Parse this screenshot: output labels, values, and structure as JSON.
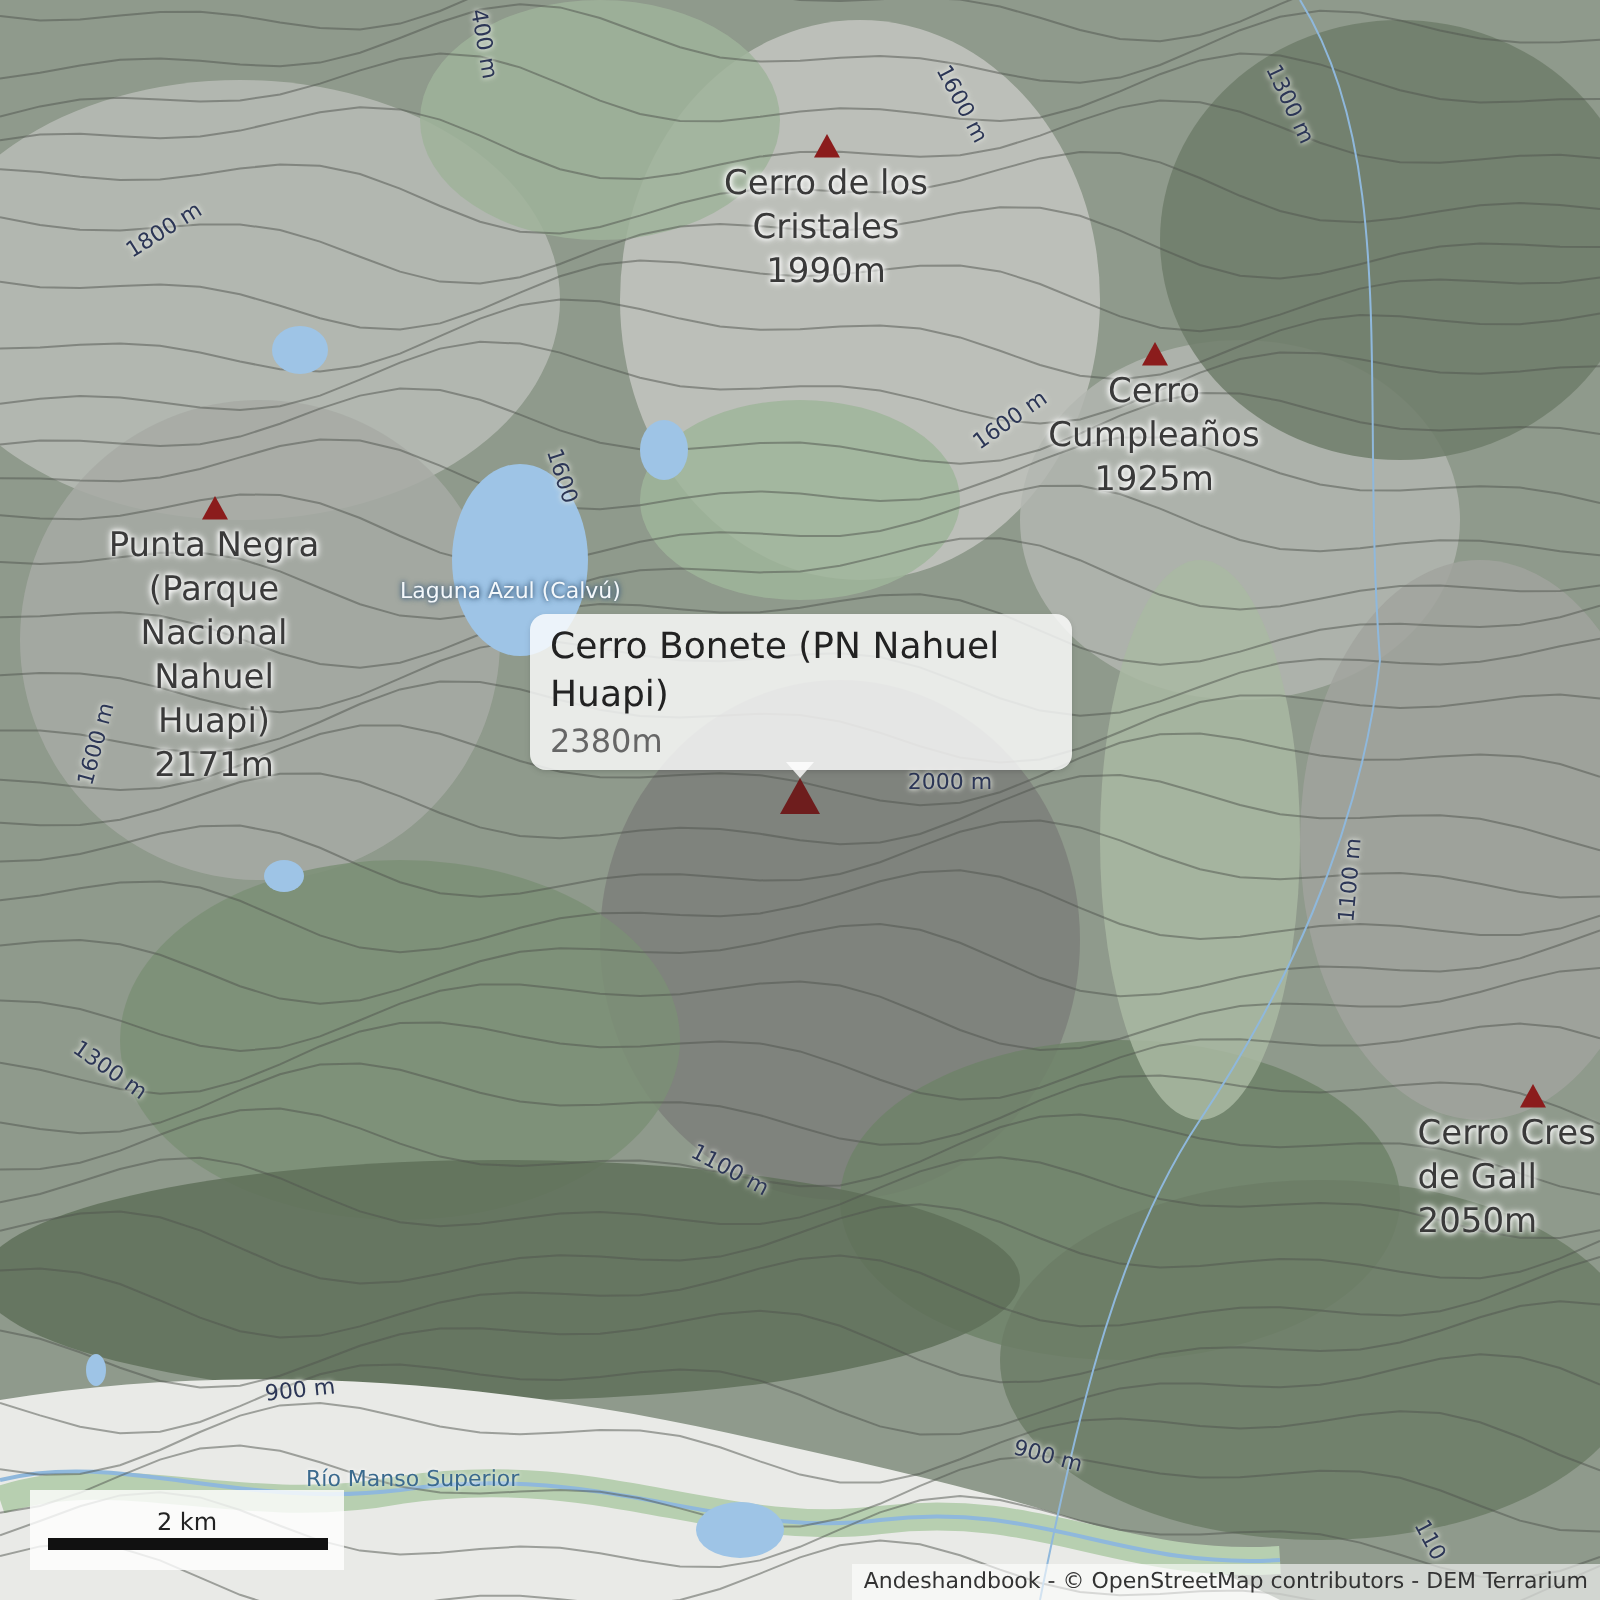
{
  "peaks": [
    {
      "label_lines": [
        "Cerro de los",
        "Cristales"
      ],
      "elevation": "1990m",
      "selected": false
    },
    {
      "label_lines": [
        "Cerro",
        "Cumpleaños"
      ],
      "elevation": "1925m",
      "selected": false
    },
    {
      "label_lines": [
        "Punta Negra",
        "(Parque",
        "Nacional",
        "Nahuel",
        "Huapi)"
      ],
      "elevation": "2171m",
      "selected": false
    },
    {
      "label_lines": [
        "Cerro Bonete (PN Nahuel",
        "Huapi)"
      ],
      "elevation": "2380m",
      "selected": true
    },
    {
      "label_lines": [
        "Cerro Cres",
        "de Gall"
      ],
      "elevation": "2050m",
      "selected": false
    }
  ],
  "water_labels": [
    "Laguna Azul (Calvú)",
    "Río Manso Superior"
  ],
  "contour_labels": [
    "400 m",
    "1600 m",
    "1300 m",
    "1800 m",
    "1600",
    "1600 m",
    "1600 m",
    "2000 m",
    "1300 m",
    "1100 m",
    "1100 m",
    "900 m",
    "900 m",
    "110"
  ],
  "scale_bar": {
    "label": "2 km"
  },
  "attribution": "Andeshandbook - © OpenStreetMap contributors - DEM Terrarium"
}
